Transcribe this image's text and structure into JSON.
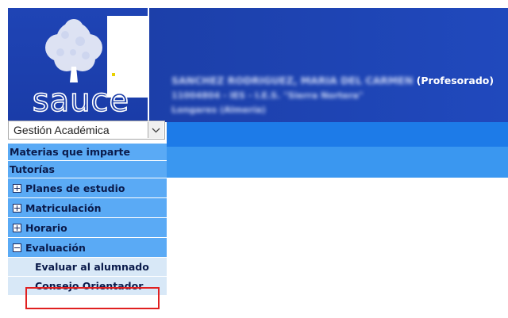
{
  "app": {
    "logo_text": "sauce",
    "colors": {
      "header_blue": "#1c3fa9",
      "menu_blue": "#5aaaf5",
      "submenu_bg": "#d8e8f7",
      "nav_bar_dark": "#1d7be8",
      "nav_bar_light": "#3a97f0",
      "highlight": "#e02020"
    }
  },
  "header": {
    "user_name": "SANCHEZ RODRIGUEZ, MARIA DEL CARMEN",
    "role": "(Profesorado)",
    "center": "11004804 - IES - I.E.S. \"Sierra Nortera\"",
    "location": "Longares (Almería)"
  },
  "sidebar": {
    "module_select": {
      "value": "Gestión Académica",
      "icon": "chevron-down-icon"
    },
    "menu": {
      "materias": "Materias que imparte",
      "tutorias": "Tutorías",
      "planes": "Planes de estudio",
      "matriculacion": "Matriculación",
      "horario": "Horario",
      "evaluacion": "Evaluación",
      "evaluar_alumnado": "Evaluar al alumnado",
      "consejo_orientador": "Consejo Orientador"
    }
  }
}
